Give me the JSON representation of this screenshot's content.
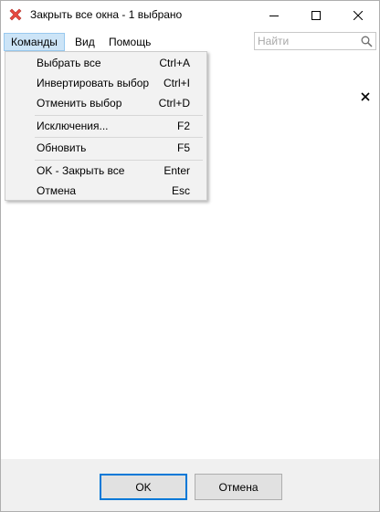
{
  "window": {
    "title": "Закрыть все окна - 1 выбрано"
  },
  "menubar": {
    "items": [
      "Команды",
      "Вид",
      "Помощь"
    ]
  },
  "search": {
    "placeholder": "Найти",
    "value": ""
  },
  "dropdown": {
    "items": [
      {
        "label": "Выбрать все",
        "shortcut": "Ctrl+A"
      },
      {
        "label": "Инвертировать выбор",
        "shortcut": "Ctrl+I"
      },
      {
        "label": "Отменить выбор",
        "shortcut": "Ctrl+D"
      },
      {
        "label": "Исключения...",
        "shortcut": "F2"
      },
      {
        "label": "Обновить",
        "shortcut": "F5"
      },
      {
        "label": "OK - Закрыть все",
        "shortcut": "Enter"
      },
      {
        "label": "Отмена",
        "shortcut": "Esc"
      }
    ]
  },
  "footer": {
    "ok_label": "OK",
    "cancel_label": "Отмена"
  },
  "colors": {
    "menu_active_bg": "#cce4f7",
    "menu_active_border": "#99c9ef",
    "default_button_border": "#0078d7",
    "dropdown_bg": "#f2f2f2",
    "icon_red": "#e8493f"
  }
}
